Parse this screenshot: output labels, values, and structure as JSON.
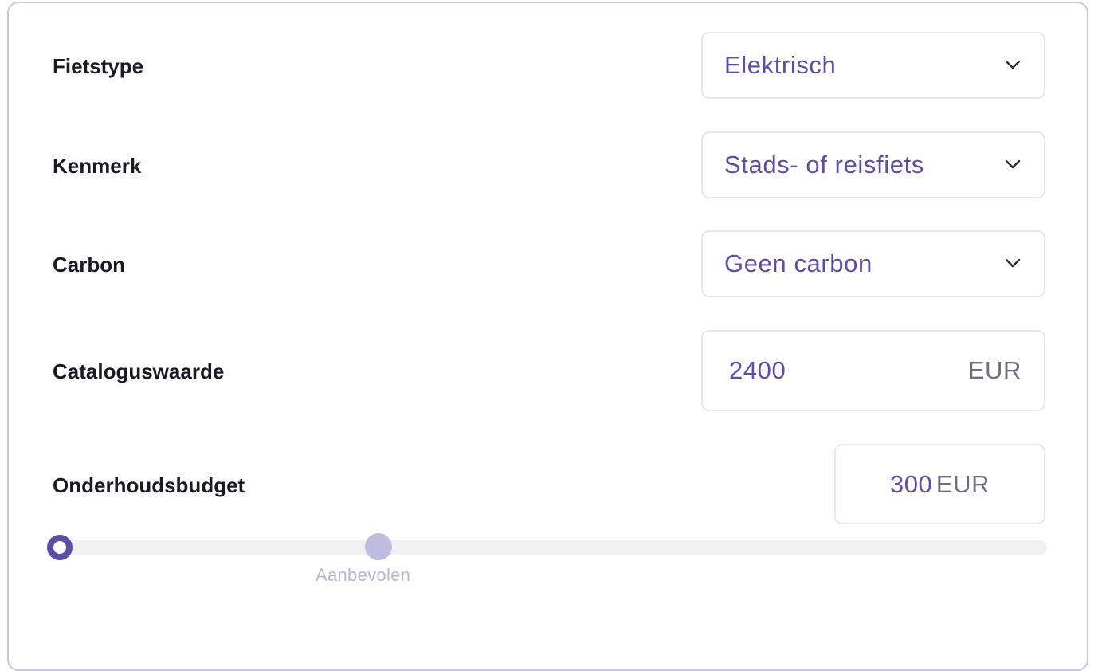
{
  "form": {
    "bike_type": {
      "label": "Fietstype",
      "value": "Elektrisch"
    },
    "feature": {
      "label": "Kenmerk",
      "value": "Stads- of reisfiets"
    },
    "carbon": {
      "label": "Carbon",
      "value": "Geen carbon"
    },
    "catalog_value": {
      "label": "Cataloguswaarde",
      "value": "2400",
      "unit": "EUR"
    },
    "maintenance_budget": {
      "label": "Onderhoudsbudget",
      "value": "300",
      "unit": "EUR",
      "slider_fraction": 0,
      "recommended_label": "Aanbevolen"
    }
  },
  "icons": {
    "dropdown": "chevron-down-icon"
  },
  "colors": {
    "accent": "#5a4fa3",
    "label_text": "#1a1a24",
    "unit_text": "#6d6e80",
    "border": "#e7e7ec",
    "card_border": "#c5c8dc",
    "slider_track": "#f0f0f3",
    "recommended": "#bebde0"
  }
}
